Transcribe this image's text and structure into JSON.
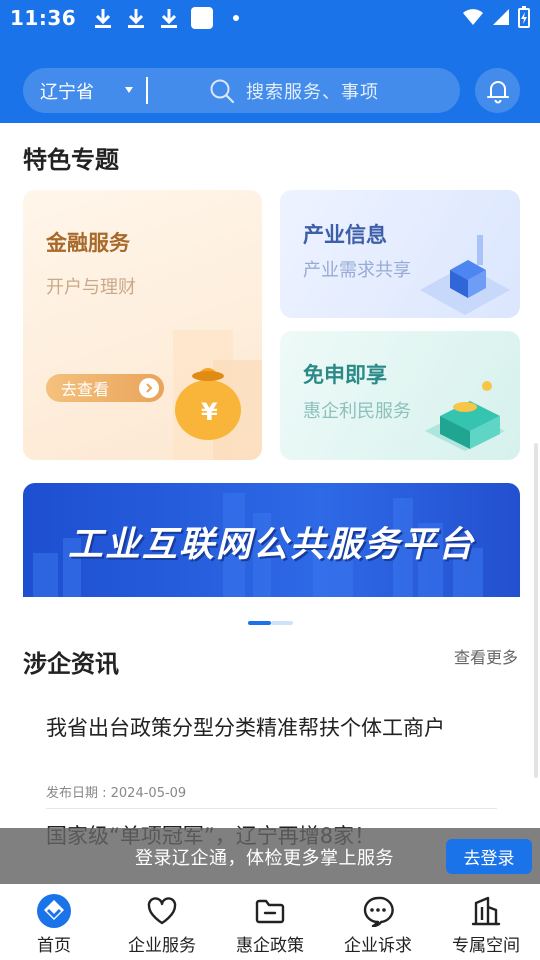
{
  "status_bar": {
    "time": "11:36"
  },
  "header": {
    "province": "辽宁省",
    "search_placeholder": "搜索服务、事项"
  },
  "featured": {
    "title": "特色专题",
    "finance": {
      "title": "金融服务",
      "subtitle": "开户与理财",
      "button": "去查看"
    },
    "industry": {
      "title": "产业信息",
      "subtitle": "产业需求共享"
    },
    "free": {
      "title": "免申即享",
      "subtitle": "惠企利民服务"
    }
  },
  "banner": {
    "text": "工业互联网公共服务平台"
  },
  "news": {
    "title": "涉企资讯",
    "more": "查看更多",
    "items": [
      {
        "title": "我省出台政策分型分类精准帮扶个体工商户",
        "date": "发布日期 : 2024-05-09"
      },
      {
        "title": "国家级“单项冠军”，辽宁再增8家！"
      }
    ]
  },
  "login_prompt": {
    "text": "登录辽企通，体检更多掌上服务",
    "button": "去登录"
  },
  "bottom_nav": [
    {
      "label": "首页",
      "icon": "home-logo-icon"
    },
    {
      "label": "企业服务",
      "icon": "heart-icon"
    },
    {
      "label": "惠企政策",
      "icon": "folder-icon"
    },
    {
      "label": "企业诉求",
      "icon": "chat-icon"
    },
    {
      "label": "专属空间",
      "icon": "building-icon"
    }
  ],
  "colors": {
    "primary": "#1a73e8",
    "finance_title": "#a8692a",
    "industry_title": "#3d5ea8",
    "free_title": "#2a8a87"
  }
}
